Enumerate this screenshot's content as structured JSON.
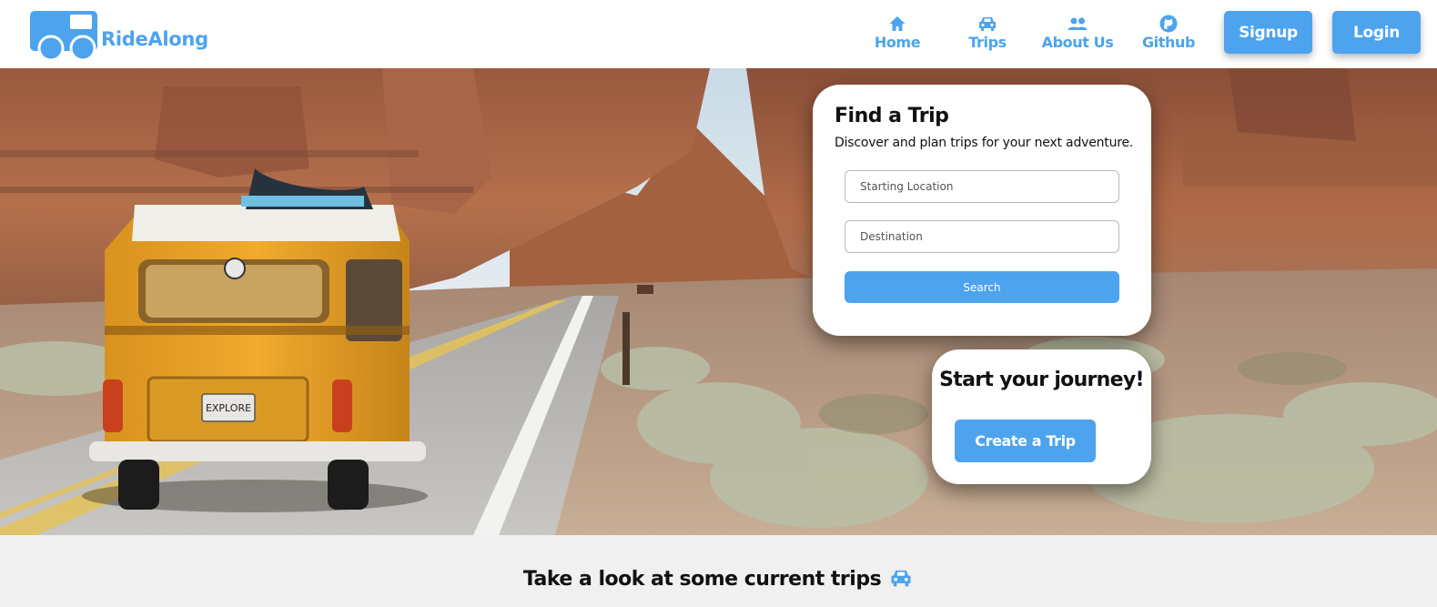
{
  "brand": {
    "name": "RideAlong",
    "accent_color": "#4da3ee"
  },
  "nav": {
    "items": [
      {
        "label": "Home",
        "icon": "home-icon"
      },
      {
        "label": "Trips",
        "icon": "car-icon"
      },
      {
        "label": "About Us",
        "icon": "people-icon"
      },
      {
        "label": "Github",
        "icon": "github-icon"
      }
    ],
    "signup_label": "Signup",
    "login_label": "Login"
  },
  "hero": {
    "image_subject": "yellow camper van on desert road with red rock cliffs",
    "license_plate": "EXPLORE"
  },
  "find_trip": {
    "title": "Find a Trip",
    "subtitle": "Discover and plan trips for your next adventure.",
    "start_placeholder": "Starting Location",
    "destination_placeholder": "Destination",
    "search_label": "Search"
  },
  "start_journey": {
    "title": "Start your journey!",
    "button_label": "Create a Trip"
  },
  "current_trips": {
    "heading": "Take a look at some current trips",
    "icon": "car-icon"
  }
}
